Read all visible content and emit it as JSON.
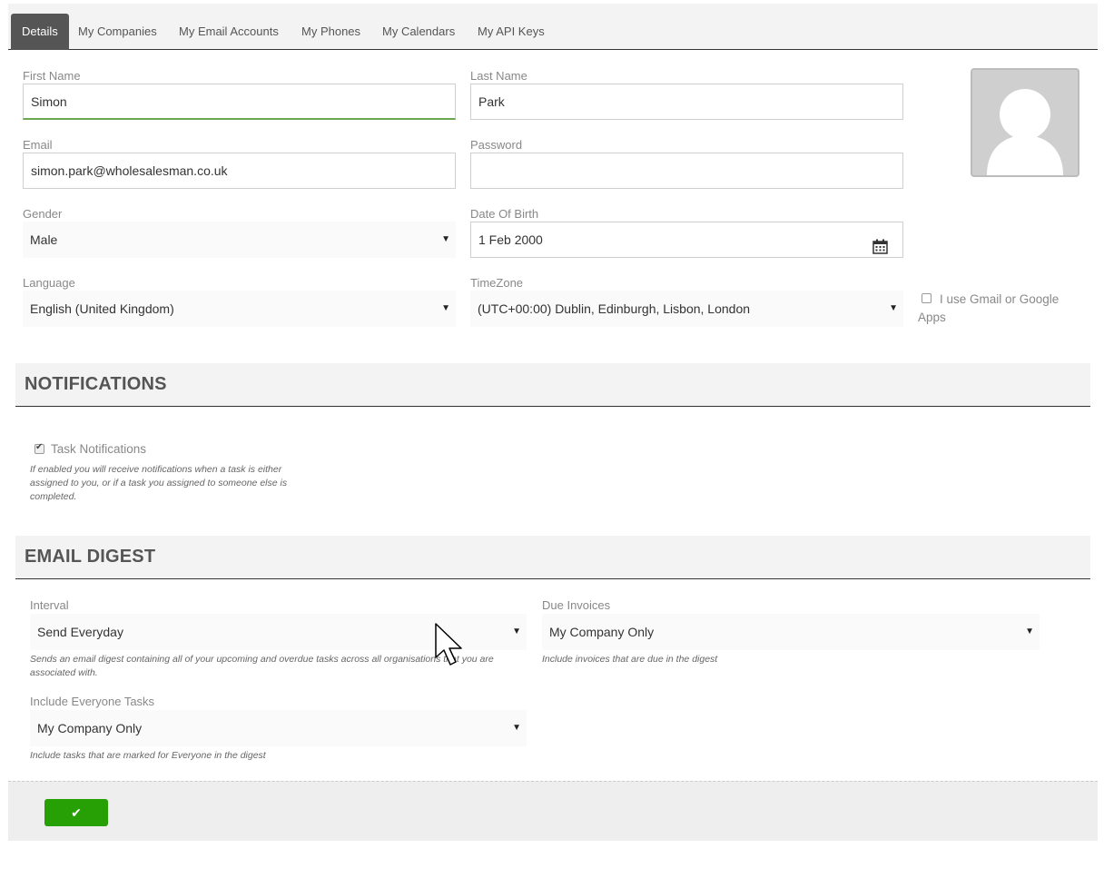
{
  "tabs": [
    {
      "label": "Details",
      "active": true
    },
    {
      "label": "My Companies",
      "active": false
    },
    {
      "label": "My Email Accounts",
      "active": false
    },
    {
      "label": "My Phones",
      "active": false
    },
    {
      "label": "My Calendars",
      "active": false
    },
    {
      "label": "My API Keys",
      "active": false
    }
  ],
  "details": {
    "first_name_label": "First Name",
    "first_name_value": "Simon",
    "last_name_label": "Last Name",
    "last_name_value": "Park",
    "email_label": "Email",
    "email_value": "simon.park@wholesalesman.co.uk",
    "password_label": "Password",
    "password_value": "",
    "gender_label": "Gender",
    "gender_value": "Male",
    "dob_label": "Date Of Birth",
    "dob_value": "1 Feb 2000",
    "language_label": "Language",
    "language_value": "English (United Kingdom)",
    "timezone_label": "TimeZone",
    "timezone_value": "(UTC+00:00) Dublin, Edinburgh, Lisbon, London",
    "gmail_label": "I use Gmail or Google Apps",
    "gmail_checked": false,
    "avatar_icon": "user-silhouette-icon"
  },
  "notifications": {
    "title": "NOTIFICATIONS",
    "task_label": "Task Notifications",
    "task_checked": true,
    "task_help": "If enabled you will receive notifications when a task is either assigned to you, or if a task you assigned to someone else is completed."
  },
  "digest": {
    "title": "EMAIL DIGEST",
    "interval_label": "Interval",
    "interval_value": "Send Everyday",
    "interval_help": "Sends an email digest containing all of your upcoming and overdue tasks across all organisations that you are associated with.",
    "due_label": "Due Invoices",
    "due_value": "My Company Only",
    "due_help": "Include invoices that are due in the digest",
    "everyone_label": "Include Everyone Tasks",
    "everyone_value": "My Company Only",
    "everyone_help": "Include tasks that are marked for Everyone in the digest"
  },
  "footer": {
    "save_icon": "check-icon",
    "save_glyph": "✔"
  },
  "colors": {
    "accent_green": "#27a006",
    "tab_active": "#555555"
  }
}
